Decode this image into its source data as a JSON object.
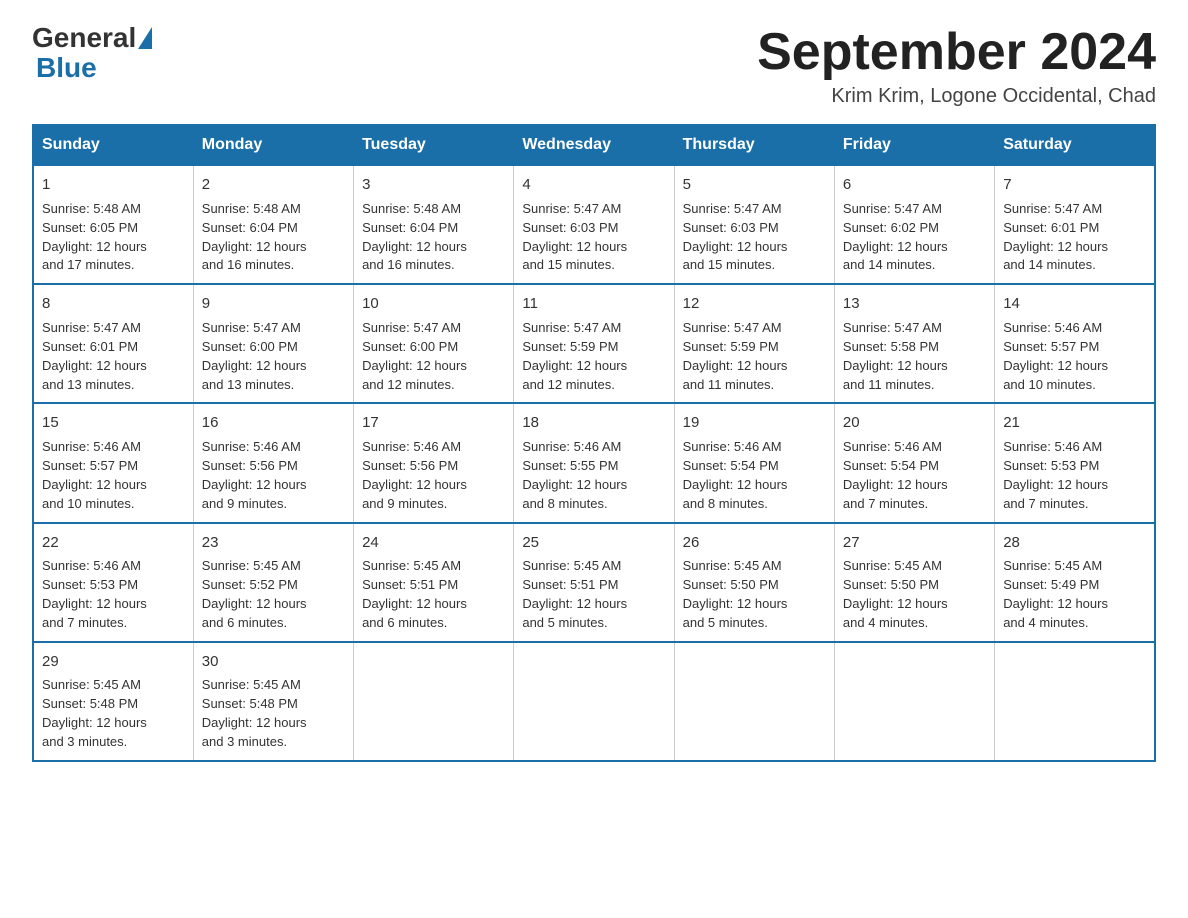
{
  "header": {
    "logo_text_general": "General",
    "logo_text_blue": "Blue",
    "month_year": "September 2024",
    "location": "Krim Krim, Logone Occidental, Chad"
  },
  "days_of_week": [
    "Sunday",
    "Monday",
    "Tuesday",
    "Wednesday",
    "Thursday",
    "Friday",
    "Saturday"
  ],
  "weeks": [
    [
      {
        "day": "1",
        "sunrise": "5:48 AM",
        "sunset": "6:05 PM",
        "daylight": "12 hours and 17 minutes."
      },
      {
        "day": "2",
        "sunrise": "5:48 AM",
        "sunset": "6:04 PM",
        "daylight": "12 hours and 16 minutes."
      },
      {
        "day": "3",
        "sunrise": "5:48 AM",
        "sunset": "6:04 PM",
        "daylight": "12 hours and 16 minutes."
      },
      {
        "day": "4",
        "sunrise": "5:47 AM",
        "sunset": "6:03 PM",
        "daylight": "12 hours and 15 minutes."
      },
      {
        "day": "5",
        "sunrise": "5:47 AM",
        "sunset": "6:03 PM",
        "daylight": "12 hours and 15 minutes."
      },
      {
        "day": "6",
        "sunrise": "5:47 AM",
        "sunset": "6:02 PM",
        "daylight": "12 hours and 14 minutes."
      },
      {
        "day": "7",
        "sunrise": "5:47 AM",
        "sunset": "6:01 PM",
        "daylight": "12 hours and 14 minutes."
      }
    ],
    [
      {
        "day": "8",
        "sunrise": "5:47 AM",
        "sunset": "6:01 PM",
        "daylight": "12 hours and 13 minutes."
      },
      {
        "day": "9",
        "sunrise": "5:47 AM",
        "sunset": "6:00 PM",
        "daylight": "12 hours and 13 minutes."
      },
      {
        "day": "10",
        "sunrise": "5:47 AM",
        "sunset": "6:00 PM",
        "daylight": "12 hours and 12 minutes."
      },
      {
        "day": "11",
        "sunrise": "5:47 AM",
        "sunset": "5:59 PM",
        "daylight": "12 hours and 12 minutes."
      },
      {
        "day": "12",
        "sunrise": "5:47 AM",
        "sunset": "5:59 PM",
        "daylight": "12 hours and 11 minutes."
      },
      {
        "day": "13",
        "sunrise": "5:47 AM",
        "sunset": "5:58 PM",
        "daylight": "12 hours and 11 minutes."
      },
      {
        "day": "14",
        "sunrise": "5:46 AM",
        "sunset": "5:57 PM",
        "daylight": "12 hours and 10 minutes."
      }
    ],
    [
      {
        "day": "15",
        "sunrise": "5:46 AM",
        "sunset": "5:57 PM",
        "daylight": "12 hours and 10 minutes."
      },
      {
        "day": "16",
        "sunrise": "5:46 AM",
        "sunset": "5:56 PM",
        "daylight": "12 hours and 9 minutes."
      },
      {
        "day": "17",
        "sunrise": "5:46 AM",
        "sunset": "5:56 PM",
        "daylight": "12 hours and 9 minutes."
      },
      {
        "day": "18",
        "sunrise": "5:46 AM",
        "sunset": "5:55 PM",
        "daylight": "12 hours and 8 minutes."
      },
      {
        "day": "19",
        "sunrise": "5:46 AM",
        "sunset": "5:54 PM",
        "daylight": "12 hours and 8 minutes."
      },
      {
        "day": "20",
        "sunrise": "5:46 AM",
        "sunset": "5:54 PM",
        "daylight": "12 hours and 7 minutes."
      },
      {
        "day": "21",
        "sunrise": "5:46 AM",
        "sunset": "5:53 PM",
        "daylight": "12 hours and 7 minutes."
      }
    ],
    [
      {
        "day": "22",
        "sunrise": "5:46 AM",
        "sunset": "5:53 PM",
        "daylight": "12 hours and 7 minutes."
      },
      {
        "day": "23",
        "sunrise": "5:45 AM",
        "sunset": "5:52 PM",
        "daylight": "12 hours and 6 minutes."
      },
      {
        "day": "24",
        "sunrise": "5:45 AM",
        "sunset": "5:51 PM",
        "daylight": "12 hours and 6 minutes."
      },
      {
        "day": "25",
        "sunrise": "5:45 AM",
        "sunset": "5:51 PM",
        "daylight": "12 hours and 5 minutes."
      },
      {
        "day": "26",
        "sunrise": "5:45 AM",
        "sunset": "5:50 PM",
        "daylight": "12 hours and 5 minutes."
      },
      {
        "day": "27",
        "sunrise": "5:45 AM",
        "sunset": "5:50 PM",
        "daylight": "12 hours and 4 minutes."
      },
      {
        "day": "28",
        "sunrise": "5:45 AM",
        "sunset": "5:49 PM",
        "daylight": "12 hours and 4 minutes."
      }
    ],
    [
      {
        "day": "29",
        "sunrise": "5:45 AM",
        "sunset": "5:48 PM",
        "daylight": "12 hours and 3 minutes."
      },
      {
        "day": "30",
        "sunrise": "5:45 AM",
        "sunset": "5:48 PM",
        "daylight": "12 hours and 3 minutes."
      },
      null,
      null,
      null,
      null,
      null
    ]
  ]
}
